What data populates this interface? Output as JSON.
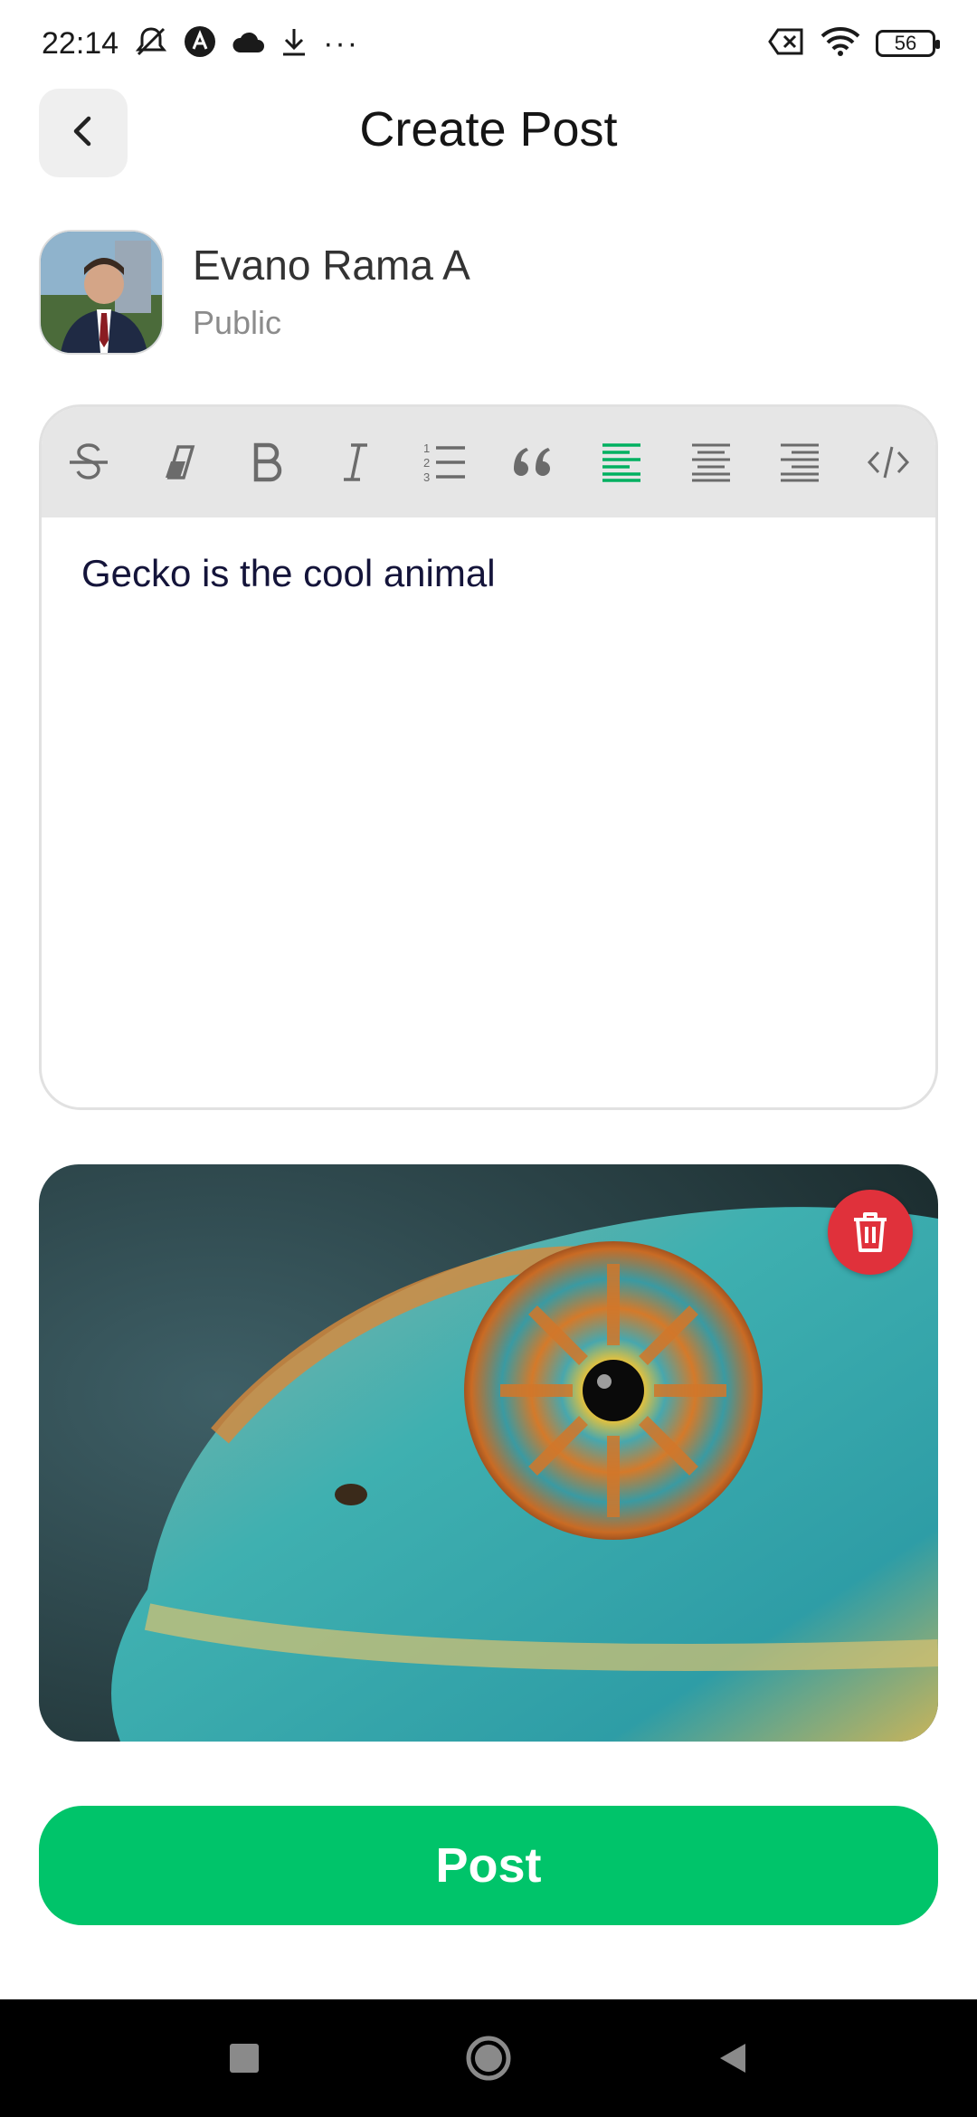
{
  "status_bar": {
    "time": "22:14",
    "battery": "56"
  },
  "header": {
    "title": "Create Post"
  },
  "author": {
    "name": "Evano Rama A",
    "visibility": "Public"
  },
  "editor": {
    "content": "Gecko is the cool animal",
    "toolbar": [
      "strikethrough",
      "clear-format",
      "bold",
      "italic",
      "ordered-list",
      "blockquote",
      "align-left",
      "align-center",
      "align-right",
      "code"
    ],
    "active_tool": "align-left",
    "active_color": "#00b060"
  },
  "attachment": {
    "type": "image",
    "subject": "chameleon eye close-up"
  },
  "actions": {
    "post_label": "Post",
    "post_color": "#00c46a",
    "delete_color": "#e0313b"
  }
}
